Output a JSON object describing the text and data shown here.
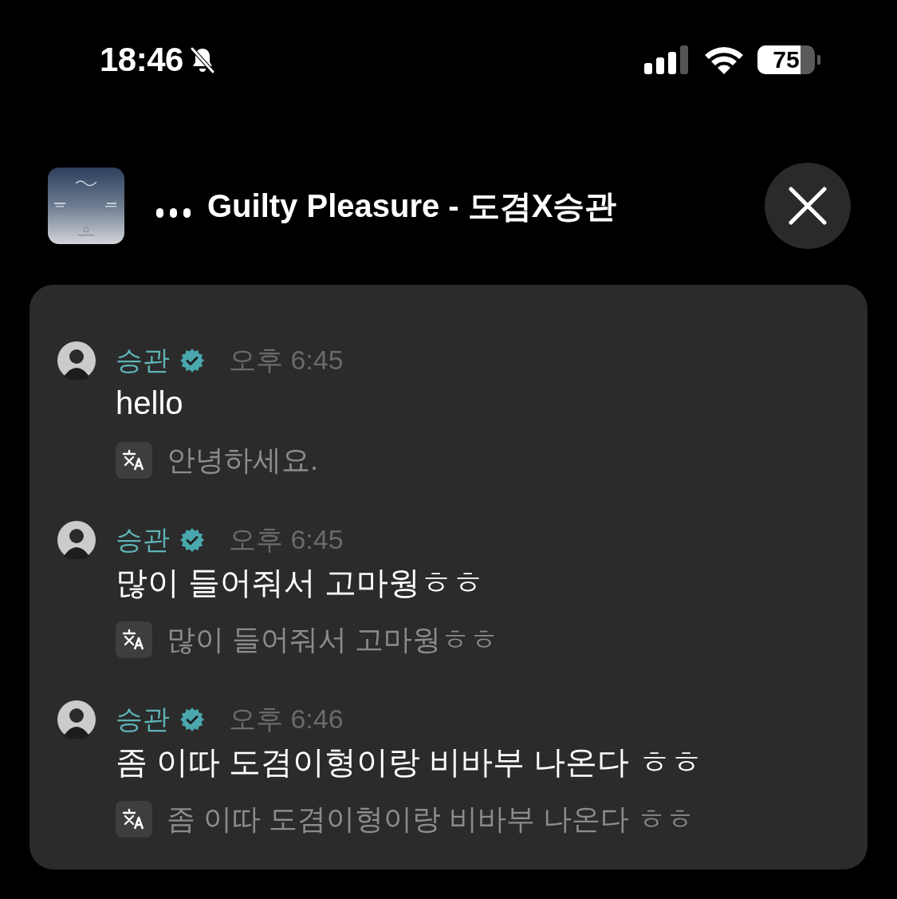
{
  "status_bar": {
    "time": "18:46",
    "silent": true,
    "battery": "75"
  },
  "now_playing": {
    "title": "Guilty Pleasure - 도겸X승관"
  },
  "messages": [
    {
      "author": "승관",
      "verified": true,
      "time": "오후 6:45",
      "text": "hello",
      "translation": "안녕하세요."
    },
    {
      "author": "승관",
      "verified": true,
      "time": "오후 6:45",
      "text": "많이 들어줘서 고마웡ㅎㅎ",
      "translation": "많이 들어줘서 고마웡ㅎㅎ"
    },
    {
      "author": "승관",
      "verified": true,
      "time": "오후 6:46",
      "text": "좀 이따 도겸이형이랑 비바부 나온다 ㅎㅎ",
      "translation": "좀 이따 도겸이형이랑 비바부 나온다 ㅎㅎ"
    }
  ]
}
